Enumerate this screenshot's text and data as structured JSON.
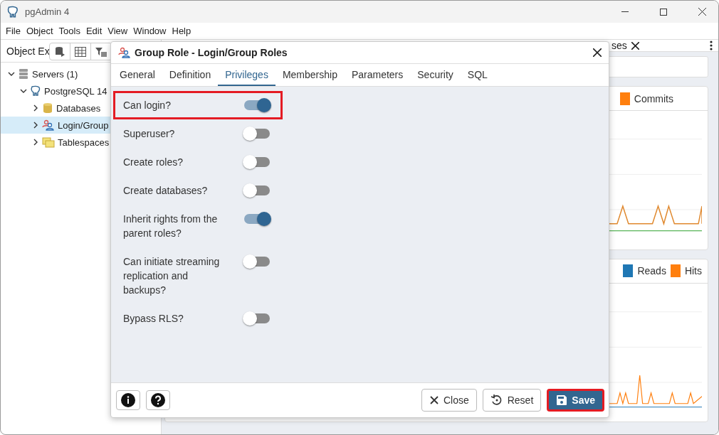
{
  "window": {
    "title": "pgAdmin 4"
  },
  "menu": [
    "File",
    "Object",
    "Tools",
    "Edit",
    "View",
    "Window",
    "Help"
  ],
  "object_explorer": {
    "title": "Object Ex",
    "tree": [
      {
        "label": "Servers (1)",
        "kind": "servers",
        "expanded": true,
        "selected": false,
        "children": [
          {
            "label": "PostgreSQL 14",
            "kind": "server",
            "expanded": true,
            "selected": false,
            "children": [
              {
                "label": "Databases",
                "kind": "databases",
                "expanded": false,
                "selected": false
              },
              {
                "label": "Login/Group",
                "kind": "roles",
                "expanded": false,
                "selected": true
              },
              {
                "label": "Tablespaces",
                "kind": "tablespaces",
                "expanded": false,
                "selected": false
              }
            ]
          }
        ]
      }
    ]
  },
  "dashboard": {
    "tab": {
      "label": "ses"
    },
    "cards": [
      {
        "legend": [
          {
            "label": "Commits",
            "color": "#ff7f0e"
          }
        ]
      },
      {
        "legend": [
          {
            "label": "Reads",
            "color": "#1f77b4"
          },
          {
            "label": "Hits",
            "color": "#ff7f0e"
          }
        ]
      }
    ]
  },
  "dialog": {
    "title": "Group Role - Login/Group Roles",
    "tabs": [
      {
        "label": "General",
        "selected": false
      },
      {
        "label": "Definition",
        "selected": false
      },
      {
        "label": "Privileges",
        "selected": true
      },
      {
        "label": "Membership",
        "selected": false
      },
      {
        "label": "Parameters",
        "selected": false
      },
      {
        "label": "Security",
        "selected": false
      },
      {
        "label": "SQL",
        "selected": false
      }
    ],
    "fields": [
      {
        "label": "Can login?",
        "on": true,
        "highlighted": true
      },
      {
        "label": "Superuser?",
        "on": false,
        "highlighted": false
      },
      {
        "label": "Create roles?",
        "on": false,
        "highlighted": false
      },
      {
        "label": "Create databases?",
        "on": false,
        "highlighted": false
      },
      {
        "label": "Inherit rights from the parent roles?",
        "on": true,
        "highlighted": false
      },
      {
        "label": "Can initiate streaming replication and backups?",
        "on": false,
        "highlighted": false
      },
      {
        "label": "Bypass RLS?",
        "on": false,
        "highlighted": false
      }
    ],
    "buttons": [
      {
        "label": "Close",
        "kind": "close",
        "highlighted": false
      },
      {
        "label": "Reset",
        "kind": "reset",
        "highlighted": false
      },
      {
        "label": "Save",
        "kind": "save",
        "highlighted": true
      }
    ]
  }
}
